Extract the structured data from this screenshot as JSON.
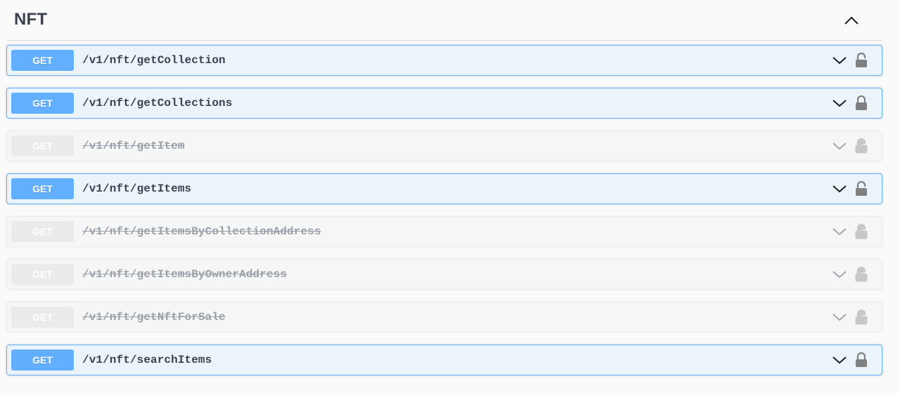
{
  "tag": {
    "title": "NFT",
    "collapse_icon": "chevron-up-icon"
  },
  "operations": [
    {
      "method": "GET",
      "path": "/v1/nft/getCollection",
      "deprecated": false
    },
    {
      "method": "GET",
      "path": "/v1/nft/getCollections",
      "deprecated": false
    },
    {
      "method": "GET",
      "path": "/v1/nft/getItem",
      "deprecated": true
    },
    {
      "method": "GET",
      "path": "/v1/nft/getItems",
      "deprecated": false
    },
    {
      "method": "GET",
      "path": "/v1/nft/getItemsByCollectionAddress",
      "deprecated": true
    },
    {
      "method": "GET",
      "path": "/v1/nft/getItemsByOwnerAddress",
      "deprecated": true
    },
    {
      "method": "GET",
      "path": "/v1/nft/getNftForSale",
      "deprecated": true
    },
    {
      "method": "GET",
      "path": "/v1/nft/searchItems",
      "deprecated": false
    }
  ],
  "icons": {
    "expand": "chevron-down-icon",
    "auth": "lock-icon"
  },
  "colors": {
    "get_method": "#61affe",
    "get_background": "#ebf3fb",
    "deprecated_background": "#f6f6f6",
    "text": "#3b4151"
  }
}
